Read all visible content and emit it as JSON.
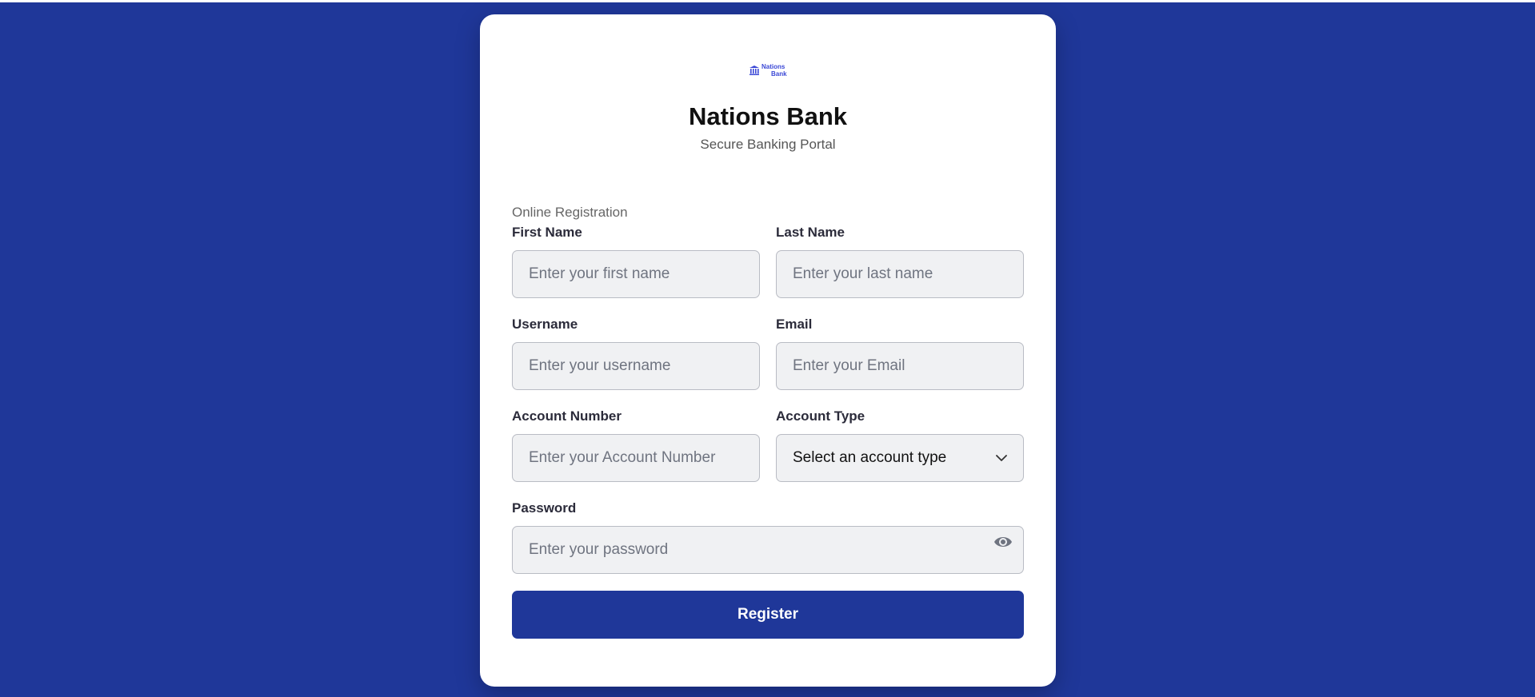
{
  "brand": {
    "logo_line1": "Nations",
    "logo_line2": "Bank",
    "title": "Nations Bank",
    "subtitle": "Secure Banking Portal",
    "accent_color": "#1f3799",
    "logo_color": "#3b48d6"
  },
  "form": {
    "section_label": "Online Registration",
    "first_name": {
      "label": "First Name",
      "placeholder": "Enter your first name",
      "value": ""
    },
    "last_name": {
      "label": "Last Name",
      "placeholder": "Enter your last name",
      "value": ""
    },
    "username": {
      "label": "Username",
      "placeholder": "Enter your username",
      "value": ""
    },
    "email": {
      "label": "Email",
      "placeholder": "Enter your Email",
      "value": ""
    },
    "account_number": {
      "label": "Account Number",
      "placeholder": "Enter your Account Number",
      "value": ""
    },
    "account_type": {
      "label": "Account Type",
      "selected": "Select an account type",
      "icon": "chevron-down-icon"
    },
    "password": {
      "label": "Password",
      "placeholder": "Enter your password",
      "value": "",
      "toggle_icon": "eye-icon"
    },
    "submit_label": "Register"
  }
}
